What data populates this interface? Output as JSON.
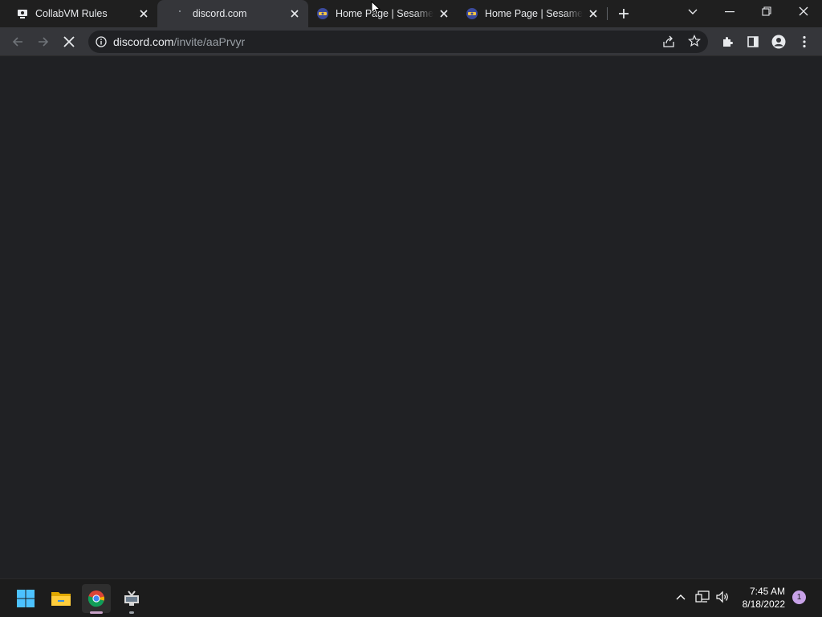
{
  "window": {
    "tabs": [
      {
        "title": "CollabVM Rules",
        "favicon": "collabvm-icon",
        "active": false
      },
      {
        "title": "discord.com",
        "favicon": "loading-icon",
        "active": true
      },
      {
        "title": "Home Page | Sesame Street",
        "favicon": "sesame-street-icon",
        "active": false
      },
      {
        "title": "Home Page | Sesame Street",
        "favicon": "sesame-street-icon",
        "active": false
      }
    ],
    "new_tab_icon": "plus-icon",
    "tab_search_icon": "chevron-down-icon",
    "controls": [
      "minimize-icon",
      "restore-icon",
      "close-icon"
    ]
  },
  "toolbar": {
    "back_icon": "back-arrow-icon",
    "forward_icon": "forward-arrow-icon",
    "stop_icon": "stop-loading-icon",
    "site_info_icon": "info-icon",
    "url_host": "discord.com",
    "url_path": "/invite/aaPrvyr",
    "share_icon": "share-icon",
    "bookmark_icon": "star-icon",
    "extensions_icon": "puzzle-icon",
    "sidepanel_icon": "side-panel-icon",
    "profile_icon": "profile-icon",
    "menu_icon": "kebab-menu-icon"
  },
  "taskbar": {
    "apps": [
      "windows-start-icon",
      "file-explorer-icon",
      "chrome-icon",
      "collabvm-app-icon"
    ],
    "tray": [
      "chevron-up-icon",
      "network-icon",
      "volume-icon"
    ],
    "time": "7:45 AM",
    "date": "8/18/2022",
    "notification_count": "1"
  },
  "colors": {
    "page_background": "#202124",
    "tabstrip": "#1f1f1f",
    "toolbar": "#35363a",
    "taskbar": "#1c1c1c",
    "accent": "#c8a2e8"
  }
}
